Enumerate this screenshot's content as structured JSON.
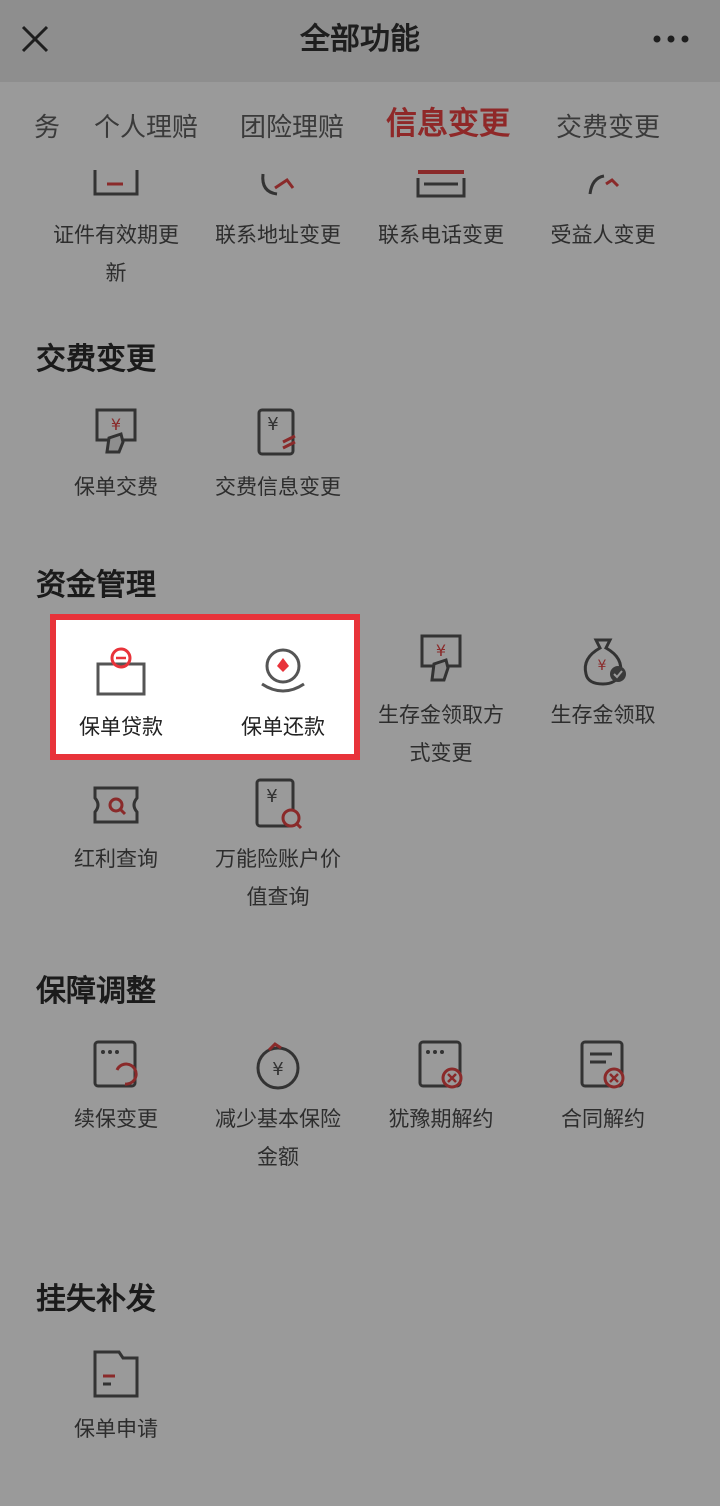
{
  "header": {
    "title": "全部功能"
  },
  "tabs": [
    {
      "label": "务"
    },
    {
      "label": "个人理赔"
    },
    {
      "label": "团险理赔"
    },
    {
      "label": "信息变更"
    },
    {
      "label": "交费变更"
    }
  ],
  "info_change": {
    "items": [
      {
        "label": "证件有效期更新"
      },
      {
        "label": "联系地址变更"
      },
      {
        "label": "联系电话变更"
      },
      {
        "label": "受益人变更"
      }
    ]
  },
  "payment_change": {
    "title": "交费变更",
    "items": [
      {
        "label": "保单交费"
      },
      {
        "label": "交费信息变更"
      }
    ]
  },
  "fund_management": {
    "title": "资金管理",
    "items": [
      {
        "label": "保单贷款"
      },
      {
        "label": "保单还款"
      },
      {
        "label": "生存金领取方式变更"
      },
      {
        "label": "生存金领取"
      },
      {
        "label": "红利查询"
      },
      {
        "label": "万能险账户价值查询"
      }
    ]
  },
  "coverage_adjustment": {
    "title": "保障调整",
    "items": [
      {
        "label": "续保变更"
      },
      {
        "label": "减少基本保险金额"
      },
      {
        "label": "犹豫期解约"
      },
      {
        "label": "合同解约"
      }
    ]
  },
  "loss_reissue": {
    "title": "挂失补发",
    "items": [
      {
        "label": "保单申请"
      }
    ]
  },
  "colors": {
    "accent": "#e8333a",
    "active_tab": "#8f2828",
    "overlay_background": "#9a9a9a",
    "highlight_background": "#ffffff"
  }
}
